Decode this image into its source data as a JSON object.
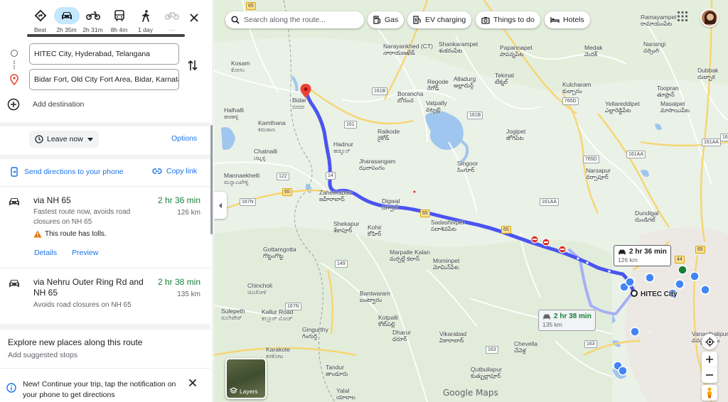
{
  "travel_modes": [
    {
      "name": "best",
      "label": "Best"
    },
    {
      "name": "driving",
      "label": "2h 35m"
    },
    {
      "name": "two-wheeler",
      "label": "2h 31m"
    },
    {
      "name": "transit",
      "label": "8h 4m"
    },
    {
      "name": "walking",
      "label": "1 day"
    },
    {
      "name": "cycling",
      "label": "—"
    }
  ],
  "directions": {
    "origin": "HITEC City, Hyderabad, Telangana",
    "destination": "Bidar Fort, Old City Fort Area, Bidar, Karnataka",
    "add_destination": "Add destination",
    "leave_now": "Leave now",
    "options": "Options",
    "send_to_phone": "Send directions to your phone",
    "copy_link": "Copy link"
  },
  "routes": [
    {
      "name": "via NH 65",
      "time": "2 hr 36 min",
      "distance": "126 km",
      "description": "Fastest route now, avoids road closures on NH 65",
      "warning": "This route has tolls.",
      "details": "Details",
      "preview": "Preview"
    },
    {
      "name": "via Nehru Outer Ring Rd and NH 65",
      "time": "2 hr 38 min",
      "distance": "135 km",
      "description": "Avoids road closures on NH 65"
    }
  ],
  "explore": {
    "title": "Explore new places along this route",
    "subtitle": "Add suggested stops"
  },
  "notification": {
    "text": "New! Continue your trip, tap the notification on your phone to get directions"
  },
  "map": {
    "search_placeholder": "Search along the route...",
    "chips": [
      "Gas",
      "EV charging",
      "Things to do",
      "Hotels"
    ],
    "layers_label": "Layers",
    "logo": "Google Maps",
    "route_colors": {
      "primary": "#4a54f0",
      "alternate": "#a6aff5"
    },
    "callout_primary": {
      "time": "2 hr 36 min",
      "distance": "126 km"
    },
    "callout_alternate": {
      "time": "2 hr 38 min",
      "distance": "135 km"
    },
    "destination_label": {
      "en": "Bidar",
      "local": "ಬೀದರ"
    },
    "origin_label": "HITEC City",
    "places": [
      {
        "en": "Kosam",
        "local": "ಕೋಸಂ"
      },
      {
        "en": "Halhalli",
        "local": "ಹಳಹಳ್ಳಿ"
      },
      {
        "en": "Kamthana",
        "local": "ಕಮಠಾಣ"
      },
      {
        "en": "Chatnalli",
        "local": "ಚಟ್ನಳ್ಳಿ"
      },
      {
        "en": "Mannaekhelli",
        "local": "ಮನ್ನಾಎಖೇಳ್ಳಿ"
      },
      {
        "en": "Hadnur",
        "local": "ಹಡ್ನೂರ್"
      },
      {
        "en": "Jharasangam",
        "local": "ఝరాసంగం"
      },
      {
        "en": "Raikode",
        "local": "రైకోడ్"
      },
      {
        "en": "Boranchа",
        "local": "బోరంచ"
      },
      {
        "en": "Narayankhed (CT)",
        "local": "నారాయణఖేడ్"
      },
      {
        "en": "Shankarampet",
        "local": "శంకరంపేట"
      },
      {
        "en": "Regode",
        "local": "రేగోడ్"
      },
      {
        "en": "Alladurg",
        "local": "అల్లాదుర్గ్"
      },
      {
        "en": "Papannapet",
        "local": "పాపన్నపేట"
      },
      {
        "en": "Medak",
        "local": "మెదక్"
      },
      {
        "en": "Tekmal",
        "local": "టేక్మల్"
      },
      {
        "en": "Vatpally",
        "local": "వట్పల్లి"
      },
      {
        "en": "Kulcharam",
        "local": "కుల్చారం"
      },
      {
        "en": "Ramayampet",
        "local": "రామాయంపేట"
      },
      {
        "en": "Narsingi",
        "local": "నర్సింగి"
      },
      {
        "en": "Dubbak",
        "local": "దుబ్బాక"
      },
      {
        "en": "Yellareddipet",
        "local": "ఎల్లారెడ్డిపేట"
      },
      {
        "en": "Toopran",
        "local": "తూప్రాన్"
      },
      {
        "en": "Masaipet",
        "local": "మాసాయిపేట"
      },
      {
        "en": "Jogipet",
        "local": "జోగిపేట"
      },
      {
        "en": "Singoor",
        "local": "సింగూర్"
      },
      {
        "en": "Narsapur",
        "local": "నర్సాపూర్"
      },
      {
        "en": "Zaheerabad",
        "local": "జహీరాబాద్"
      },
      {
        "en": "Digwal",
        "local": "దిగ్వాల్"
      },
      {
        "en": "Sadashivpet",
        "local": "సదాశివపేట"
      },
      {
        "en": "Shekapur",
        "local": "శేకాపూర్"
      },
      {
        "en": "Kohir",
        "local": "కోహిర్"
      },
      {
        "en": "Marpalle Kalan",
        "local": "మర్పల్లే కలాన్"
      },
      {
        "en": "Mominpet",
        "local": "మోమిన్‌పేట"
      },
      {
        "en": "Dundigal",
        "local": "దుండిగల్"
      },
      {
        "en": "Gottamgotta",
        "local": "గొట్టంగొట్ట"
      },
      {
        "en": "Chincholi",
        "local": "ಚಿಂಚೋಳಿ"
      },
      {
        "en": "Bantwaram",
        "local": "బంట్వారం"
      },
      {
        "en": "Sulepeth",
        "local": "ಸುಲೇಪೇಠ್"
      },
      {
        "en": "Kallur Road",
        "local": "ಕಲ್ಲೂರ್ ರೋಡ್"
      },
      {
        "en": "Kotpalli",
        "local": "కోట్‌పల్లి"
      },
      {
        "en": "Gingurthy",
        "local": "గింగుర్తి"
      },
      {
        "en": "Dharur",
        "local": "ధరూర్"
      },
      {
        "en": "Vikarabad",
        "local": "వికారాబాద్"
      },
      {
        "en": "Chevella",
        "local": "చేవెళ్ల"
      },
      {
        "en": "Karakote",
        "local": "ಕರಕೋಟ"
      },
      {
        "en": "Tandur",
        "local": "తాండూరు"
      },
      {
        "en": "Qutbullapur",
        "local": "కుత్బుల్లాపూర్"
      },
      {
        "en": "Yalal",
        "local": "యాలాల"
      },
      {
        "en": "Vanasthalipuram",
        "local": "వనస్థలిపురం"
      }
    ],
    "shields": [
      "65",
      "161B",
      "161B",
      "765D",
      "161",
      "14",
      "122",
      "65",
      "167N",
      "65",
      "65",
      "765D",
      "161AA",
      "161AA",
      "161AA",
      "161AA",
      "149",
      "167N",
      "163",
      "163",
      "44",
      "65"
    ]
  }
}
